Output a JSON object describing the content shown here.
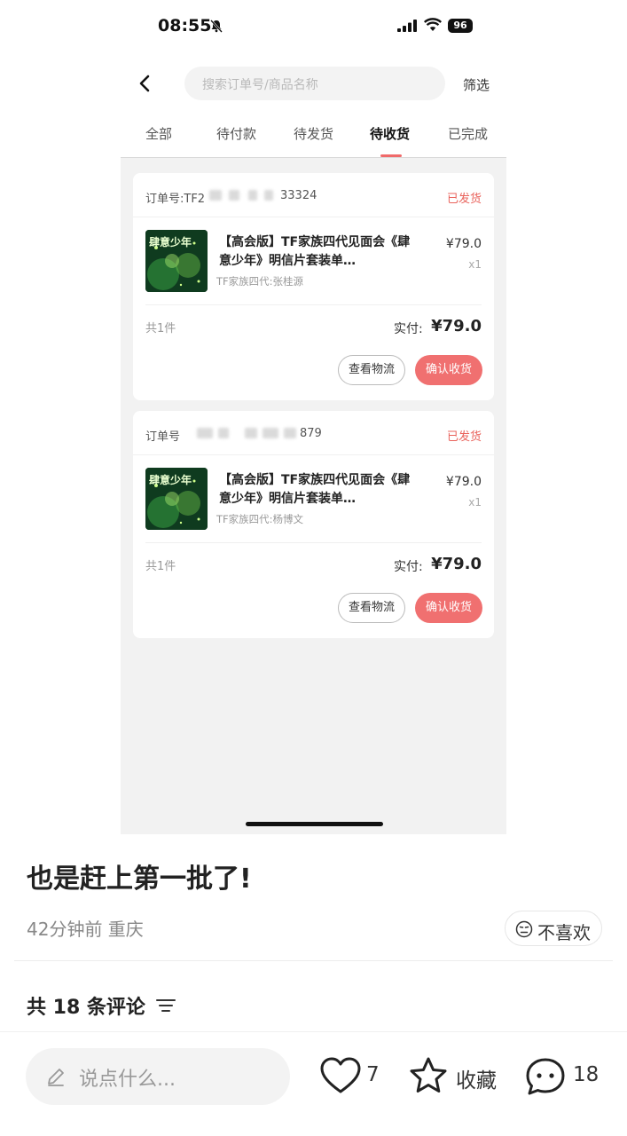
{
  "status_bar": {
    "time": "08:55",
    "battery": "96"
  },
  "order_app": {
    "search_placeholder": "搜索订单号/商品名称",
    "filter": "筛选",
    "tabs": [
      "全部",
      "待付款",
      "待发货",
      "待收货",
      "已完成"
    ],
    "active_tab": "待收货",
    "orders": [
      {
        "order_no_prefix": "订单号:TF2",
        "order_no_suffix": "33324",
        "status": "已发货",
        "title": "【高会版】TF家族四代见面会《肆意少年》明信片套装单…",
        "subtitle": "TF家族四代:张桂源",
        "price": "¥79.0",
        "qty": "x1",
        "count": "共1件",
        "paid_label": "实付:",
        "paid": "¥79.0",
        "btn_logistics": "查看物流",
        "btn_confirm": "确认收货",
        "thumb_text": "肆意少年"
      },
      {
        "order_no_prefix": "订单号",
        "order_no_suffix": "879",
        "status": "已发货",
        "title": "【高会版】TF家族四代见面会《肆意少年》明信片套装单…",
        "subtitle": "TF家族四代:杨博文",
        "price": "¥79.0",
        "qty": "x1",
        "count": "共1件",
        "paid_label": "实付:",
        "paid": "¥79.0",
        "btn_logistics": "查看物流",
        "btn_confirm": "确认收货",
        "thumb_text": "肆意少年"
      }
    ]
  },
  "post": {
    "text": "也是赶上第一批了!",
    "meta": "42分钟前 重庆",
    "dislike": "不喜欢",
    "comments_header": "共 18 条评论"
  },
  "bottom_bar": {
    "input_placeholder": "说点什么...",
    "likes": "7",
    "favorite": "收藏",
    "comments": "18"
  },
  "colors": {
    "accent": "#f07070",
    "status_red": "#e9635c"
  }
}
